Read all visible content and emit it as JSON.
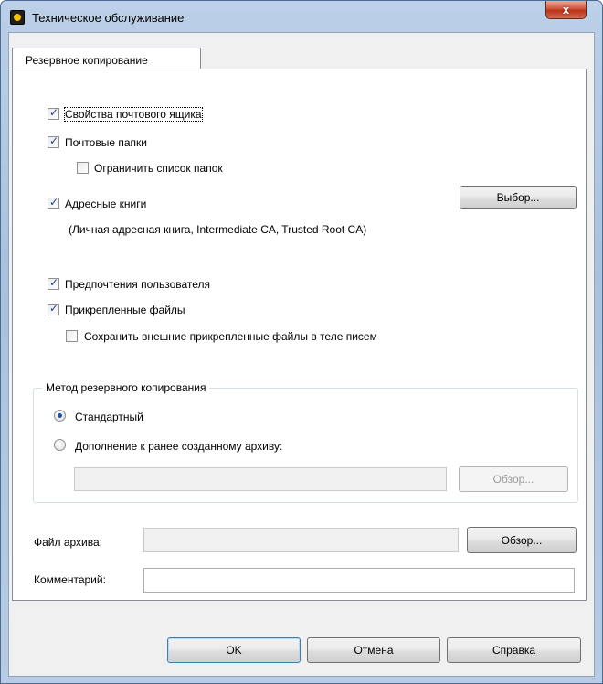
{
  "window": {
    "title": "Техническое обслуживание",
    "close_label": "x"
  },
  "tabs": [
    {
      "label": "Резервное копирование",
      "active": true
    }
  ],
  "options": {
    "mailbox_properties": {
      "label": "Свойства почтового ящика",
      "checked": true
    },
    "mail_folders": {
      "label": "Почтовые папки",
      "checked": true
    },
    "limit_folders": {
      "label": "Ограничить список папок",
      "checked": false
    },
    "address_books": {
      "label": "Адресные книги",
      "checked": true
    },
    "address_books_list": "(Личная адресная книга, Intermediate CA, Trusted Root CA)",
    "user_preferences": {
      "label": "Предпочтения пользователя",
      "checked": true
    },
    "attachments": {
      "label": "Прикрепленные файлы",
      "checked": true
    },
    "keep_external_attachments": {
      "label": "Сохранить внешние прикрепленные файлы в теле писем",
      "checked": false
    }
  },
  "select_button": "Выбор...",
  "backup_method": {
    "title": "Метод резервного копирования",
    "standard": {
      "label": "Стандартный",
      "selected": true
    },
    "append": {
      "label": "Дополнение к ранее созданному архиву:",
      "selected": false
    },
    "append_path": "",
    "browse_label": "Обзор..."
  },
  "archive_file": {
    "label": "Файл архива:",
    "value": "",
    "browse_label": "Обзор..."
  },
  "comment": {
    "label": "Комментарий:",
    "value": ""
  },
  "footer": {
    "ok": "OK",
    "cancel": "Отмена",
    "help": "Справка"
  }
}
